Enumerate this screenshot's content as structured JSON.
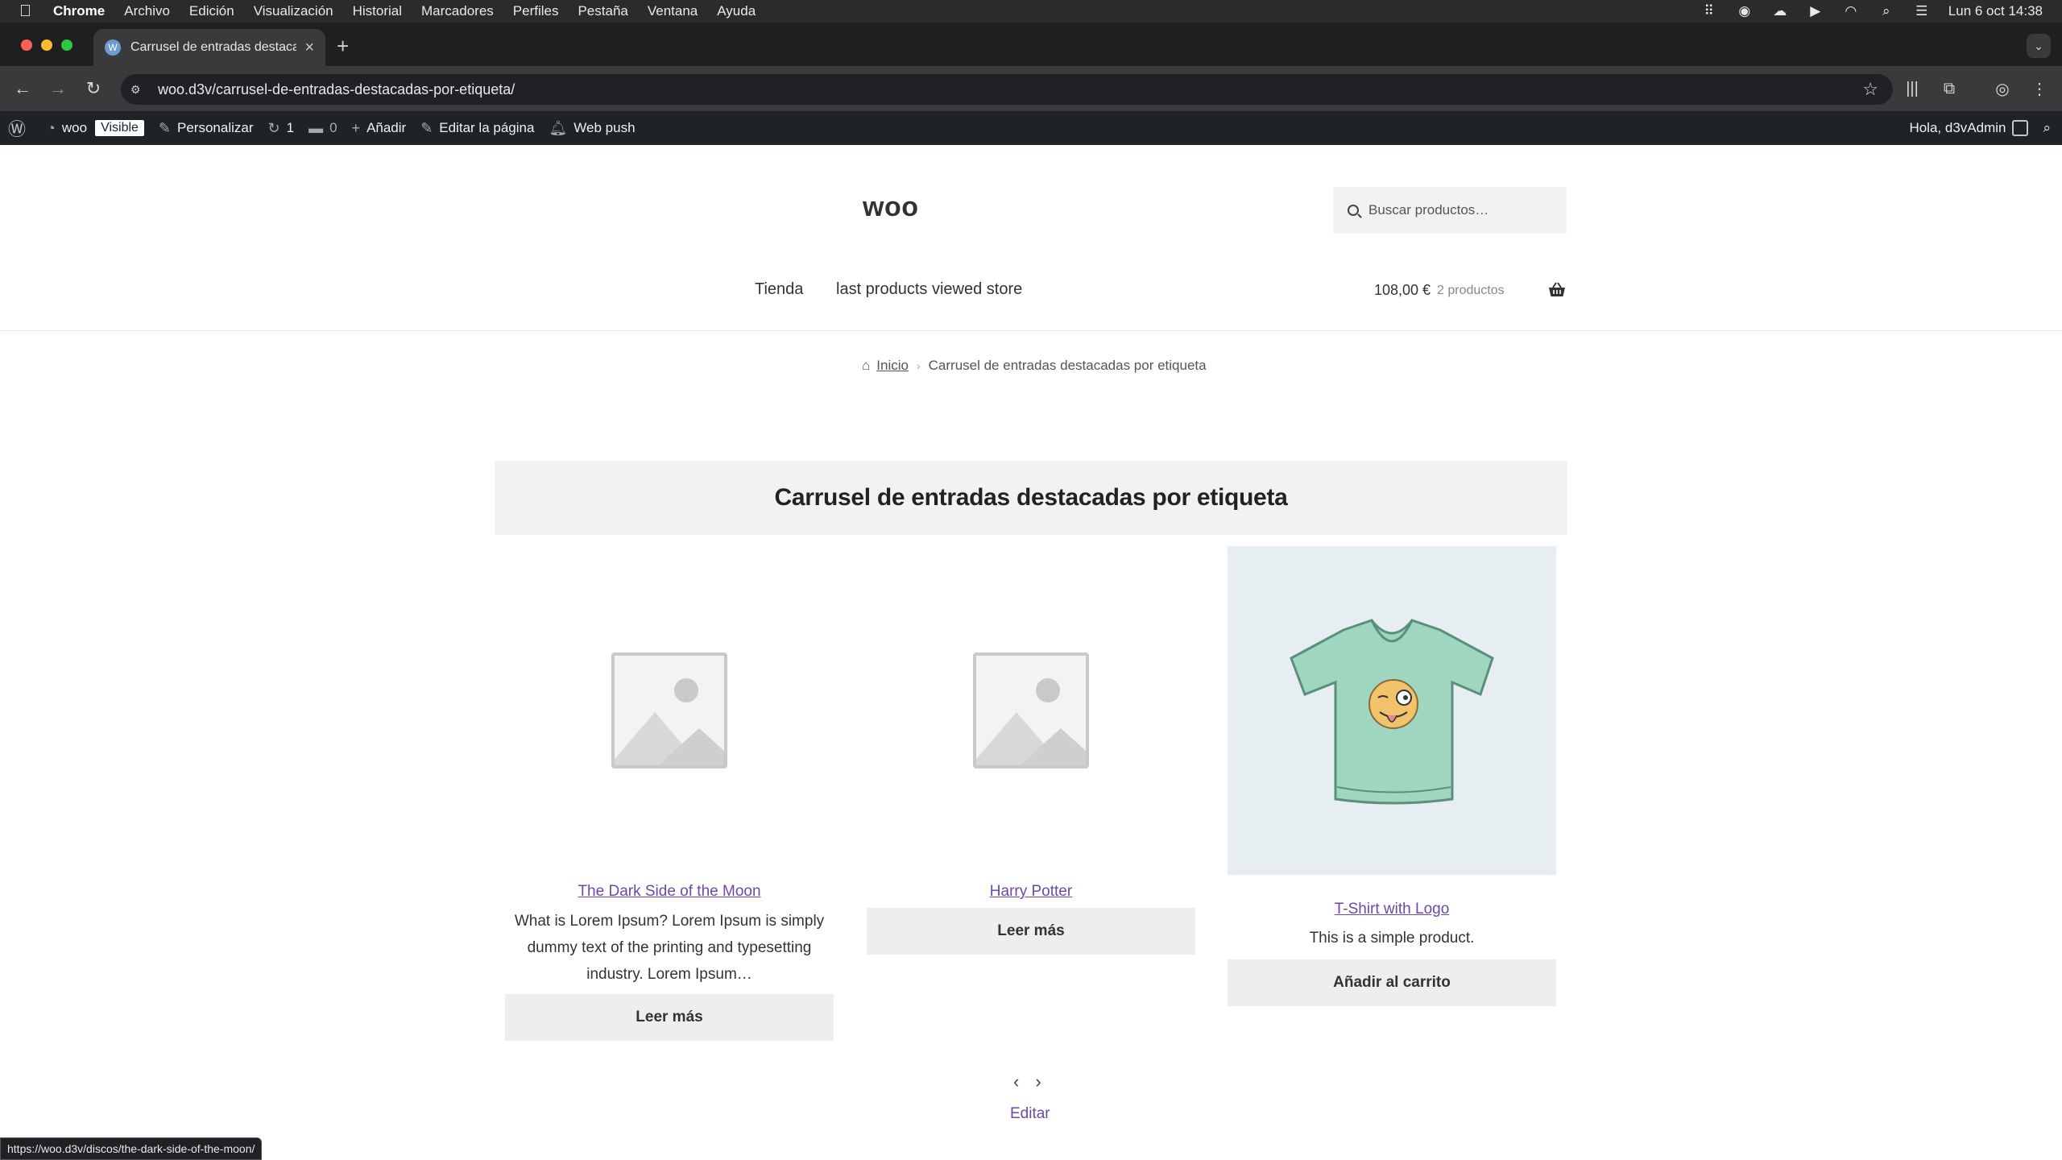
{
  "menubar": {
    "app": "Chrome",
    "items": [
      "Archivo",
      "Edición",
      "Visualización",
      "Historial",
      "Marcadores",
      "Perfiles",
      "Pestaña",
      "Ventana",
      "Ayuda"
    ],
    "datetime": "Lun 6 oct 14:38",
    "status_icons": [
      "tailscale-icon",
      "network-monitor-icon",
      "cloud-icon",
      "play-icon",
      "wifi-icon",
      "spotlight-icon",
      "control-center-icon"
    ]
  },
  "browser": {
    "tab_title": "Carrusel de entradas destacadas por etiqueta",
    "url": "woo.d3v/carrusel-de-entradas-destacadas-por-etiqueta/",
    "status_url": "https://woo.d3v/discos/the-dark-side-of-the-moon/"
  },
  "adminbar": {
    "site": "woo",
    "visibility_badge": "Visible",
    "customize": "Personalizar",
    "updates": "1",
    "comments": "0",
    "add_new": "Añadir",
    "edit_page": "Editar la página",
    "web_push": "Web push",
    "greeting": "Hola, d3vAdmin"
  },
  "header": {
    "site_title": "woo",
    "search_placeholder": "Buscar productos…",
    "nav": [
      "Tienda",
      "last products viewed store"
    ],
    "cart_amount": "108,00 €",
    "cart_count": "2 productos"
  },
  "breadcrumb": {
    "home": "Inicio",
    "current": "Carrusel de entradas destacadas por etiqueta"
  },
  "main": {
    "title": "Carrusel de entradas destacadas por etiqueta",
    "products": [
      {
        "title": "The Dark Side of the Moon",
        "description": "What is Lorem Ipsum? Lorem Ipsum is simply dummy text of the printing and typesetting industry. Lorem Ipsum…",
        "button": "Leer más",
        "image": "placeholder-image-icon"
      },
      {
        "title": "Harry Potter",
        "description": "",
        "button": "Leer más",
        "image": "placeholder-image-icon"
      },
      {
        "title": "T-Shirt with Logo",
        "description": "This is a simple product.",
        "button": "Añadir al carrito",
        "image": "tshirt-image"
      }
    ],
    "prev_arrow": "‹",
    "next_arrow": "›",
    "edit_link": "Editar"
  },
  "colors": {
    "link": "#6b4aa6",
    "admin_bar": "#1d2327",
    "title_box": "#f2f2f2",
    "button_bg": "#eeeeee"
  }
}
